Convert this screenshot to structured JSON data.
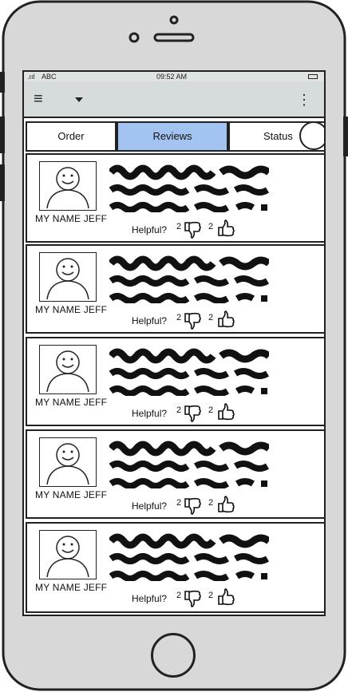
{
  "status_bar": {
    "signal": ".ııl",
    "carrier": "ABC",
    "time": "09:52 AM"
  },
  "app_bar": {
    "menu_icon": "hamburger-menu-icon",
    "dropdown_icon": "caret-down-icon",
    "overflow_icon": "vertical-ellipsis-icon"
  },
  "tabs": [
    {
      "label": "Order",
      "active": false
    },
    {
      "label": "Reviews",
      "active": true
    },
    {
      "label": "Status",
      "active": false
    }
  ],
  "reviews": [
    {
      "name": "MY NAME JEFF",
      "helpful_label": "Helpful?",
      "dislikes": "2",
      "likes": "2"
    },
    {
      "name": "MY NAME JEFF",
      "helpful_label": "Helpful?",
      "dislikes": "2",
      "likes": "2"
    },
    {
      "name": "MY NAME JEFF",
      "helpful_label": "Helpful?",
      "dislikes": "2",
      "likes": "2"
    },
    {
      "name": "MY NAME JEFF",
      "helpful_label": "Helpful?",
      "dislikes": "2",
      "likes": "2"
    },
    {
      "name": "MY NAME JEFF",
      "helpful_label": "Helpful?",
      "dislikes": "2",
      "likes": "2"
    }
  ],
  "colors": {
    "active_tab": "#a3c4f1",
    "app_bar": "#d6dbdb",
    "phone_body": "#d8d8d8"
  }
}
